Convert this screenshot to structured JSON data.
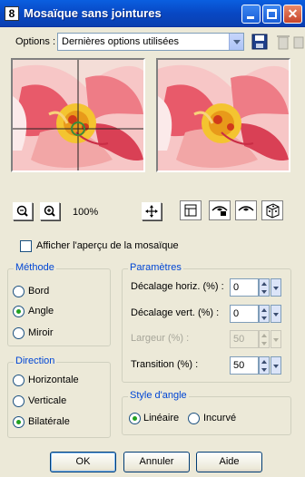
{
  "window": {
    "title": "Mosaïque sans jointures",
    "icon_label": "8"
  },
  "options": {
    "label": "Options :",
    "preset_value": "Dernières options utilisées"
  },
  "zoom": {
    "level": "100%"
  },
  "preview_checkbox": {
    "label": "Afficher l'aperçu de la mosaïque",
    "checked": false
  },
  "methode": {
    "title": "Méthode",
    "options": [
      {
        "label": "Bord",
        "selected": false
      },
      {
        "label": "Angle",
        "selected": true
      },
      {
        "label": "Miroir",
        "selected": false
      }
    ]
  },
  "direction": {
    "title": "Direction",
    "options": [
      {
        "label": "Horizontale",
        "selected": false
      },
      {
        "label": "Verticale",
        "selected": false
      },
      {
        "label": "Bilatérale",
        "selected": true
      }
    ]
  },
  "parametres": {
    "title": "Paramètres",
    "fields": [
      {
        "label": "Décalage horiz. (%) :",
        "value": "0",
        "enabled": true
      },
      {
        "label": "Décalage vert. (%) :",
        "value": "0",
        "enabled": true
      },
      {
        "label": "Largeur (%) :",
        "value": "50",
        "enabled": false
      },
      {
        "label": "Transition (%) :",
        "value": "50",
        "enabled": true
      }
    ]
  },
  "style_angle": {
    "title": "Style d'angle",
    "options": [
      {
        "label": "Linéaire",
        "selected": true
      },
      {
        "label": "Incurvé",
        "selected": false
      }
    ]
  },
  "buttons": {
    "ok": "OK",
    "cancel": "Annuler",
    "help": "Aide"
  },
  "colors": {
    "titlebar": "#0a54d8",
    "group_title": "#0046d5",
    "radio_dot": "#21a121"
  }
}
